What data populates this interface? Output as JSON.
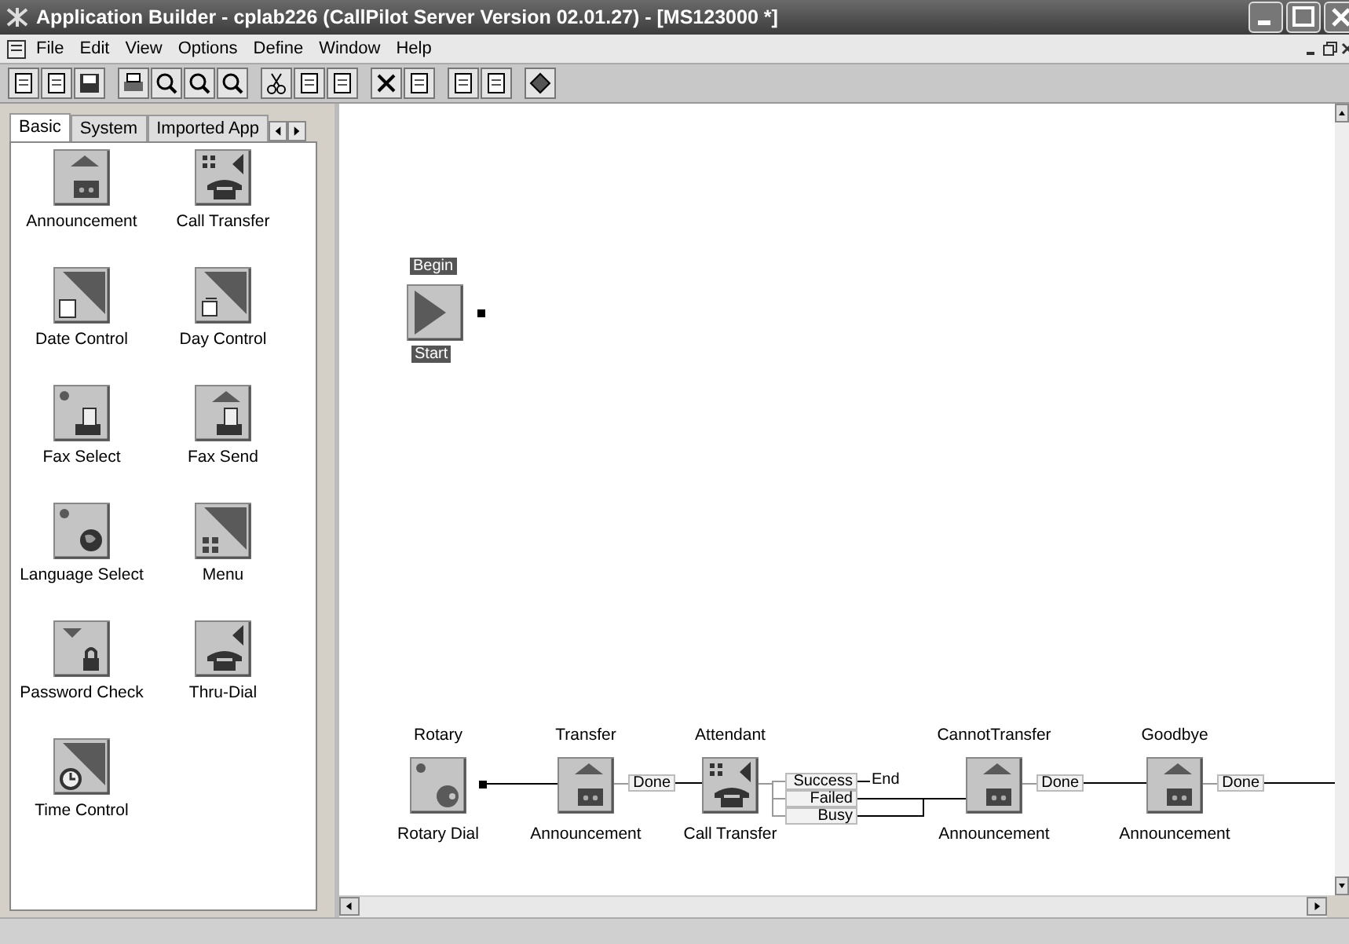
{
  "window": {
    "title": "Application Builder - cplab226 (CallPilot Server Version 02.01.27) - [MS123000 *]"
  },
  "menu": [
    "File",
    "Edit",
    "View",
    "Options",
    "Define",
    "Window",
    "Help"
  ],
  "palette": {
    "tabs": [
      {
        "label": "Basic",
        "selected": true
      },
      {
        "label": "System",
        "selected": false
      },
      {
        "label": "Imported App",
        "selected": false
      }
    ],
    "items": [
      {
        "label": "Announcement",
        "kind": "announcement"
      },
      {
        "label": "Call Transfer",
        "kind": "call-transfer"
      },
      {
        "label": "Date Control",
        "kind": "date-control"
      },
      {
        "label": "Day Control",
        "kind": "day-control"
      },
      {
        "label": "Fax Select",
        "kind": "fax-select"
      },
      {
        "label": "Fax Send",
        "kind": "fax-send"
      },
      {
        "label": "Language Select",
        "kind": "language-select"
      },
      {
        "label": "Menu",
        "kind": "menu"
      },
      {
        "label": "Password Check",
        "kind": "password-check"
      },
      {
        "label": "Thru-Dial",
        "kind": "thru-dial"
      },
      {
        "label": "Time Control",
        "kind": "time-control"
      }
    ]
  },
  "canvas": {
    "begin": {
      "top_label": "Begin",
      "bottom_label": "Start"
    },
    "nodes": [
      {
        "name": "Rotary",
        "type_label": "Rotary Dial",
        "kind": "rotary-dial"
      },
      {
        "name": "Transfer",
        "type_label": "Announcement",
        "kind": "announcement",
        "outputs": [
          {
            "label": "Done"
          }
        ]
      },
      {
        "name": "Attendant",
        "type_label": "Call Transfer",
        "kind": "call-transfer",
        "outputs": [
          {
            "label": "Success",
            "target": "End"
          },
          {
            "label": "Failed"
          },
          {
            "label": "Busy"
          }
        ]
      },
      {
        "name": "CannotTransfer",
        "type_label": "Announcement",
        "kind": "announcement",
        "outputs": [
          {
            "label": "Done"
          }
        ]
      },
      {
        "name": "Goodbye",
        "type_label": "Announcement",
        "kind": "announcement",
        "outputs": [
          {
            "label": "Done"
          }
        ]
      }
    ]
  }
}
